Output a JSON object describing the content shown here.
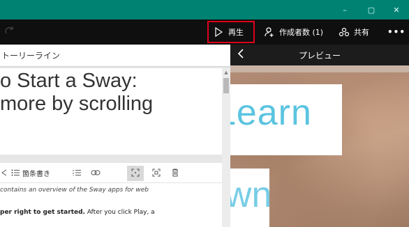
{
  "window": {
    "minimize_glyph": "–",
    "maximize_glyph": "▢",
    "close_glyph": "✕"
  },
  "toolbar": {
    "play_label": "再生",
    "authors_label": "作成者数 (1)",
    "share_label": "共有",
    "more_label": "•••",
    "accent_color": "#e0001b"
  },
  "storyline": {
    "header_label": "トーリーライン",
    "title_text": "o Start a Sway:\nmore by scrolling",
    "format_bar": {
      "bullets_label": "箇条書き"
    },
    "body_italic": "contains an overview of the Sway apps for web",
    "body_line2_bold": "per right to get started.",
    "body_line2_rest": " After you click Play, a"
  },
  "preview": {
    "header_label": "プレビュー",
    "card1_text": ": Learn",
    "card2_text": "own"
  },
  "colors": {
    "titlebar": "#008272",
    "toolbar": "#0f0f0f",
    "preview_text": "#5bc4e0"
  }
}
